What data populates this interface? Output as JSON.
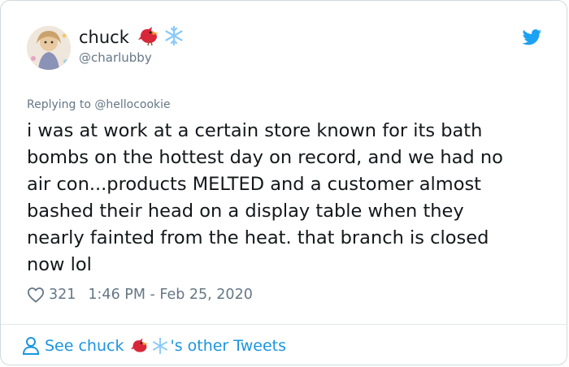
{
  "tweet": {
    "author_name": "chuck",
    "author_handle": "@charlubby",
    "replying_prefix": "Replying to",
    "replying_to": "@hellocookie",
    "body": "i was at work at a certain store known for its bath\nbombs on the hottest day on record, and we had no\nair con...products MELTED and a customer almost\nbashed their head on a display table when they\nnearly fainted from the heat. that branch is closed\nnow lol",
    "likes": "321",
    "time": "1:46 PM - Feb 25, 2020",
    "footer_prefix": "See chuck",
    "footer_suffix": "'s other Tweets"
  },
  "icons": {
    "name_emojis": [
      "cardinal-bird-emoji",
      "snowflake-emoji"
    ],
    "logo": "twitter-bird-icon",
    "like": "heart-outline-icon",
    "profile": "person-outline-icon"
  },
  "colors": {
    "twitter_blue": "#1da1f2",
    "link_blue": "#1b95e0",
    "muted": "#657786",
    "cardinal_red": "#d9273a",
    "snowflake": "#88c9f9"
  }
}
